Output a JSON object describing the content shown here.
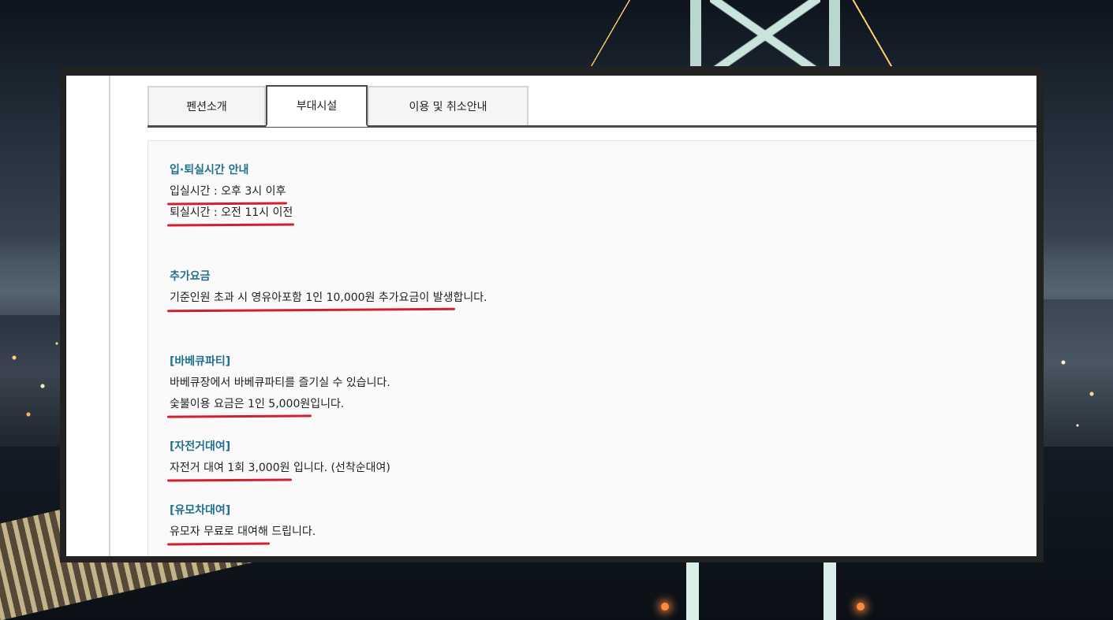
{
  "tabs": [
    {
      "label": "펜션소개",
      "active": false
    },
    {
      "label": "부대시설",
      "active": true
    },
    {
      "label": "이용 및 취소안내",
      "active": false
    }
  ],
  "sections": {
    "checkin": {
      "title": "입·퇴실시간 안내",
      "line1": "입실시간 : 오후 3시 이후",
      "line2": "퇴실시간 : 오전 11시 이전"
    },
    "extra_fee": {
      "title": "추가요금",
      "line1_marked": "기준인원 초과 시 영유아포함 1인 10,000원 추가요금이 발생",
      "line1_rest": "합니다."
    },
    "bbq": {
      "title": "[바베큐파티]",
      "line1": "바베큐장에서 바베큐파티를 즐기실 수 있습니다.",
      "line2_marked": "숯불이용 요금은 1인 5,000원",
      "line2_rest": "입니다."
    },
    "bike": {
      "title": "[자전거대여]",
      "line1_marked": "자전거 대여 1회 3,000원",
      "line1_rest": " 입니다. (선착순대여)"
    },
    "stroller": {
      "title": "[유모차대여]",
      "line1_marked": "유모자 무료로 대여해",
      "line1_rest": " 드립니다."
    }
  },
  "colors": {
    "section_title": "#1f6f8d",
    "underline_mark": "#d1202e",
    "tab_border_active": "#4b4b4b"
  }
}
